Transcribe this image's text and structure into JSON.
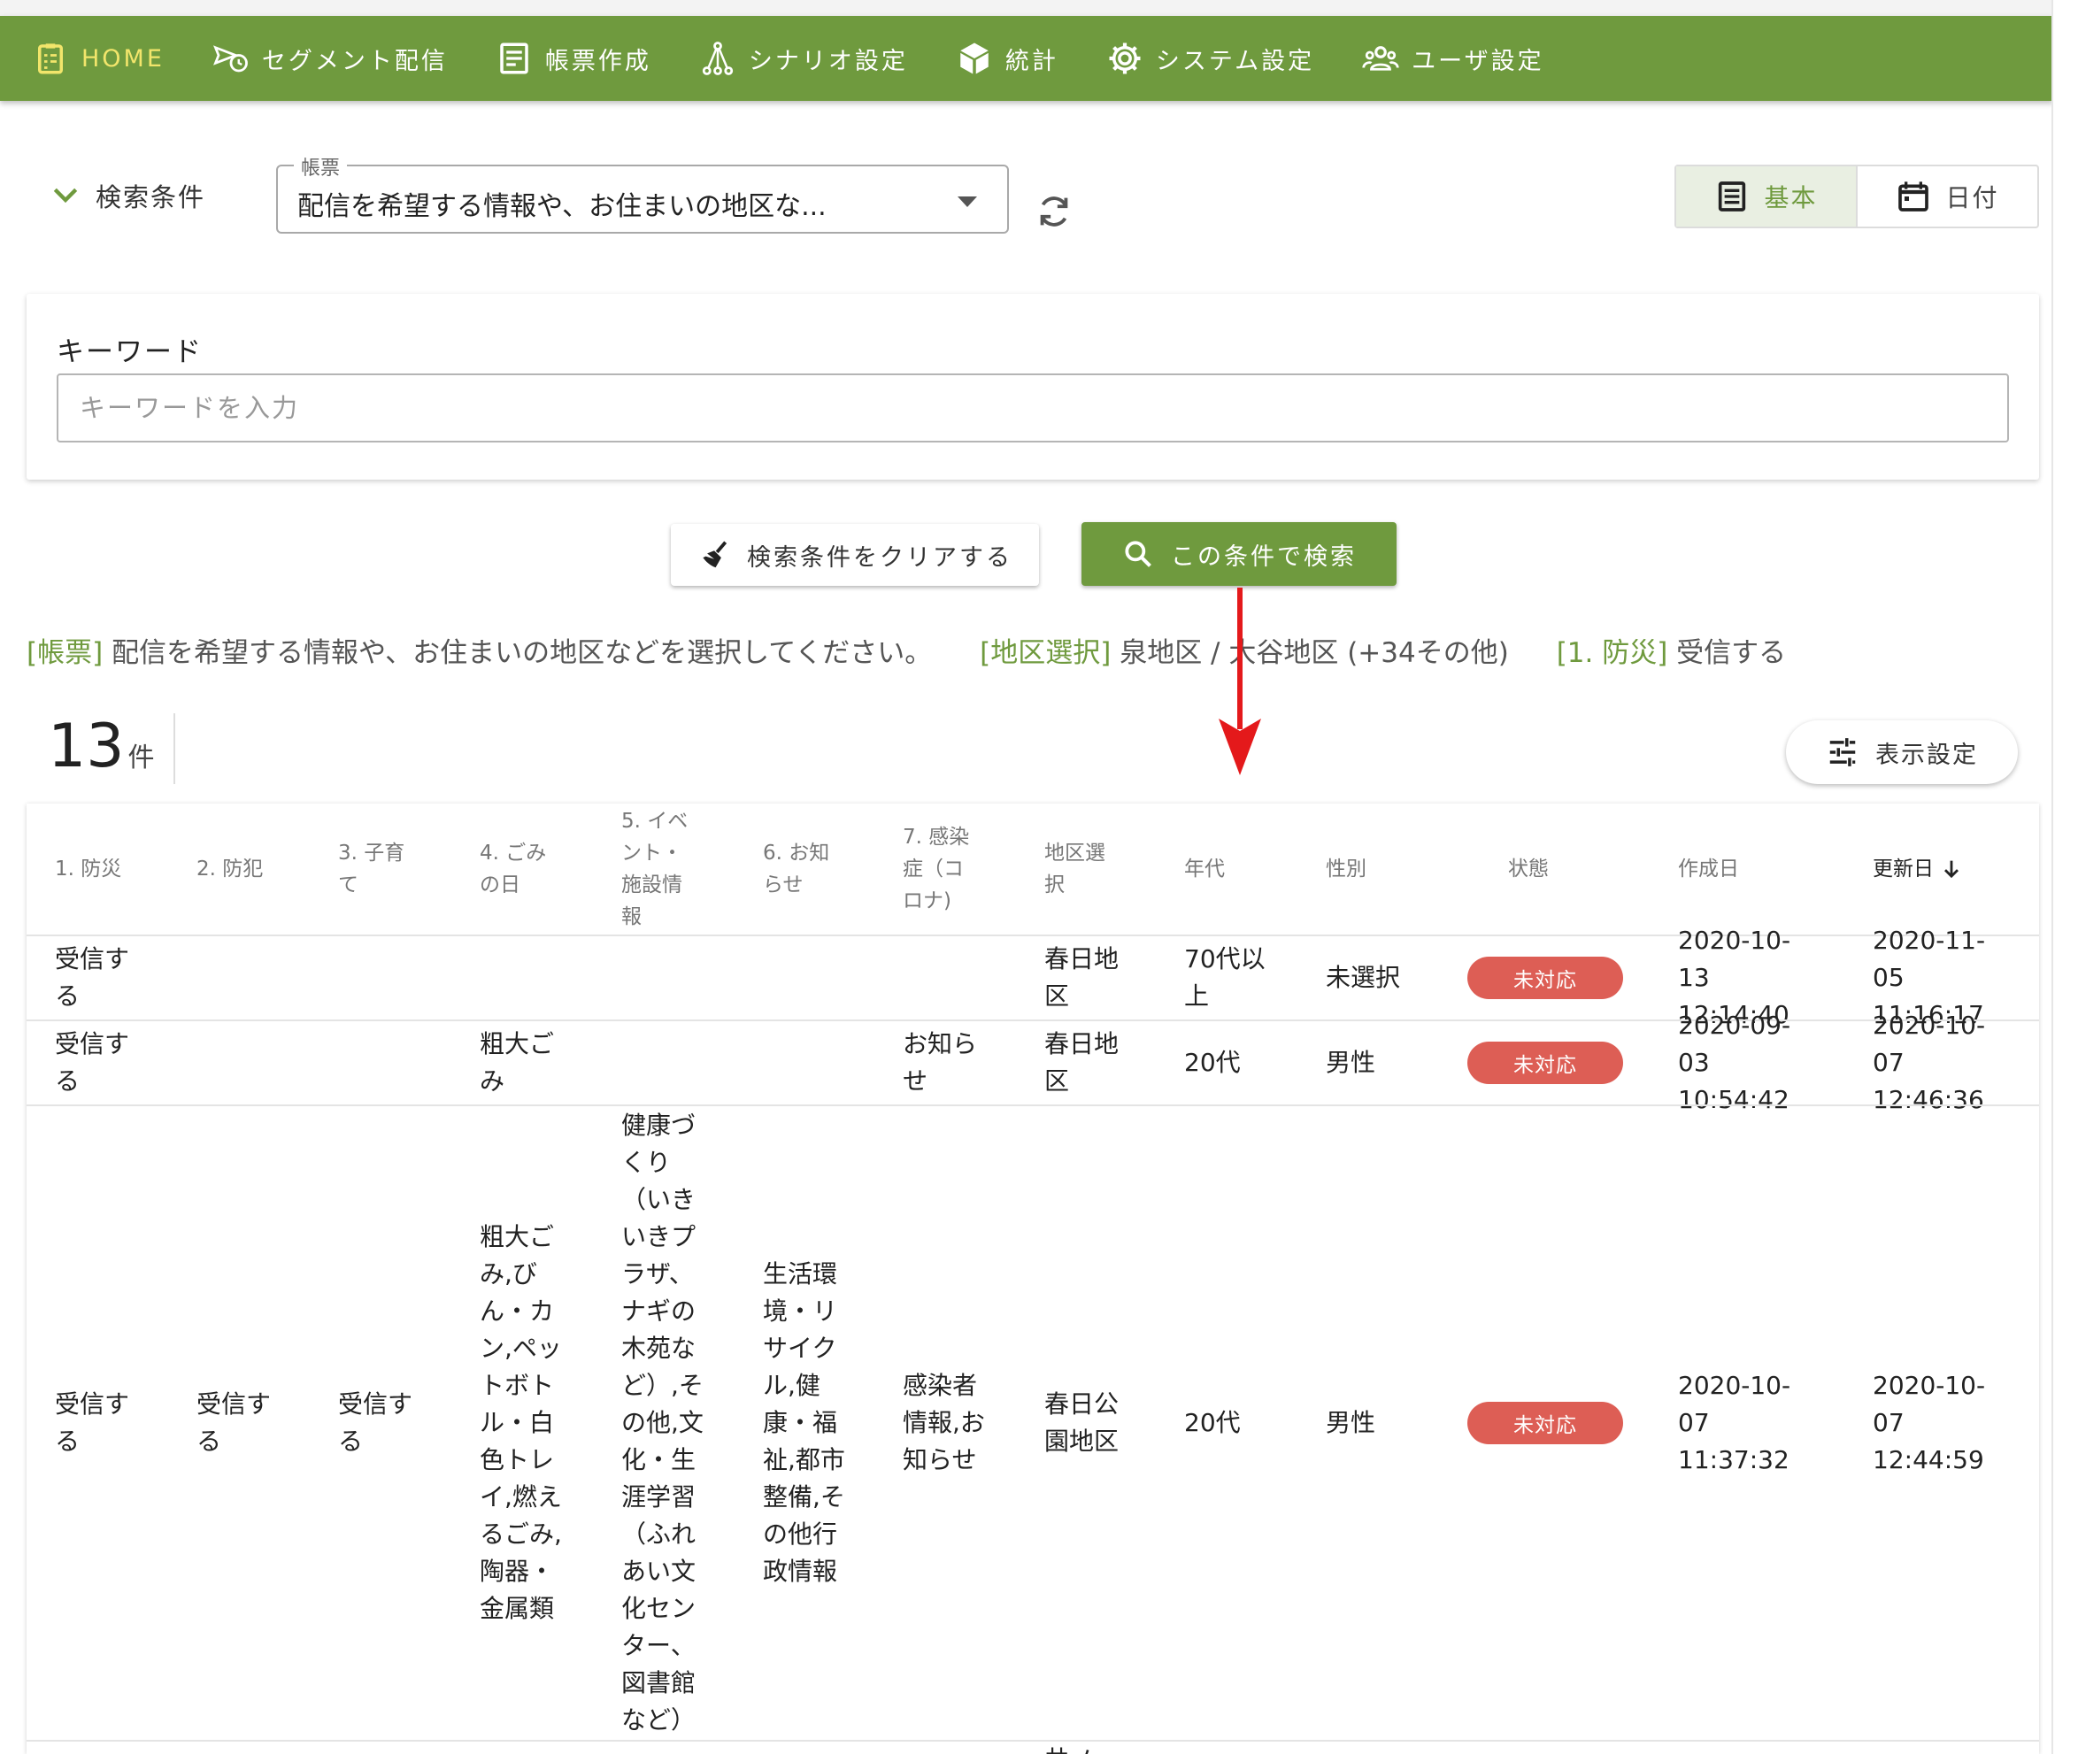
{
  "nav": {
    "items": [
      {
        "label": "HOME",
        "icon": "clipboard-list-icon",
        "active": true
      },
      {
        "label": "セグメント配信",
        "icon": "send-clock-icon"
      },
      {
        "label": "帳票作成",
        "icon": "form-document-icon"
      },
      {
        "label": "シナリオ設定",
        "icon": "scenario-tree-icon"
      },
      {
        "label": "統計",
        "icon": "cube-stats-icon"
      },
      {
        "label": "システム設定",
        "icon": "gear-icon"
      },
      {
        "label": "ユーザ設定",
        "icon": "users-icon"
      }
    ]
  },
  "search": {
    "toggle_label": "検索条件",
    "form_select_label": "帳票",
    "form_select_value": "配信を希望する情報や、お住まいの地区な...",
    "view_modes": {
      "basic": "基本",
      "date": "日付"
    },
    "keyword_label": "キーワード",
    "keyword_placeholder": "キーワードを入力",
    "keyword_value": "",
    "clear_button": "検索条件をクリアする",
    "search_button": "この条件で検索"
  },
  "summary": {
    "form_tag": "[帳票]",
    "form_value": "配信を希望する情報や、お住まいの地区などを選択してください。",
    "area_tag": "[地区選択]",
    "area_value": "泉地区 / 大谷地区 (+34その他)",
    "disaster_tag": "[1. 防災]",
    "disaster_value": "受信する"
  },
  "results": {
    "count": "13",
    "count_unit": "件",
    "display_settings_button": "表示設定"
  },
  "table": {
    "headers": [
      "1. 防災",
      "2. 防犯",
      "3. 子育て",
      "4. ごみの日",
      "5. イベント・施設情報",
      "6. お知らせ",
      "7. 感染症（コロナ)",
      "地区選択",
      "年代",
      "性別",
      "状態",
      "作成日",
      "更新日"
    ],
    "rows": [
      {
        "c1": "受信する",
        "c2": "",
        "c3": "",
        "c4": "",
        "c5": "",
        "c6": "",
        "c7": "",
        "area": "春日地区",
        "age": "70代以上",
        "gender": "未選択",
        "status": "未対応",
        "created": "2020-10-13 12:14:40",
        "updated": "2020-11-05 11:16:17"
      },
      {
        "c1": "受信する",
        "c2": "",
        "c3": "",
        "c4": "粗大ごみ",
        "c5": "",
        "c6": "",
        "c7": "お知らせ",
        "area": "春日地区",
        "age": "20代",
        "gender": "男性",
        "status": "未対応",
        "created": "2020-09-03 10:54:42",
        "updated": "2020-10-07 12:46:36"
      },
      {
        "c1": "受信する",
        "c2": "受信する",
        "c3": "受信する",
        "c4": "粗大ごみ,びん・カン,ペットボトル・白色トレイ,燃えるごみ,陶器・金属類",
        "c5": "健康づくり（いきいきプラザ、ナギの木苑など）,その他,文化・生涯学習（ふれあい文化センター、図書館など）",
        "c6": "生活環境・リサイクル,健康・福祉,都市整備,その他行政情報",
        "c7": "感染者情報,お知らせ",
        "area": "春日公園地区",
        "age": "20代",
        "gender": "男性",
        "status": "未対応",
        "created": "2020-10-07 11:37:32",
        "updated": "2020-10-07 12:44:59"
      }
    ],
    "partial_next_row_area": "井ノ"
  },
  "colors": {
    "brand": "#6f9a3e",
    "nav_active": "#f2e56b",
    "badge": "#dd5e55",
    "arrow": "#e4191b"
  }
}
